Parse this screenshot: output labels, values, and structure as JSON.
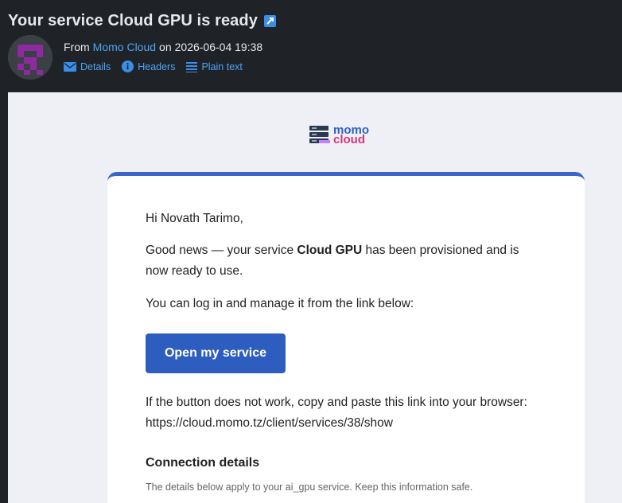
{
  "header": {
    "subject": "Your service Cloud GPU is ready",
    "from_prefix": "From",
    "sender": "Momo Cloud",
    "date_prefix": "on",
    "date": "2026-06-04 19:38",
    "actions": [
      {
        "label": "Details",
        "icon": "envelope-icon"
      },
      {
        "label": "Headers",
        "icon": "info-icon"
      },
      {
        "label": "Plain text",
        "icon": "lines-icon"
      }
    ]
  },
  "logo": {
    "line1": "momo",
    "line2": "cloud"
  },
  "email": {
    "greeting": "Hi Novath Tarimo,",
    "p1_a": "Good news — your service ",
    "p1_service": "Cloud GPU",
    "p1_b": " has been provisioned and is",
    "p1_c": "now ready to use.",
    "p2": "You can log in and manage it from the link below:",
    "cta_label": "Open my service",
    "p3": "If the button does not work, copy and paste this link into your browser:",
    "link": "https://cloud.momo.tz/client/services/38/show",
    "section_title": "Connection details",
    "section_note": "The details below apply to your ai_gpu service. Keep this information safe."
  },
  "colors": {
    "accent": "#2d5dbf",
    "link": "#4ea3f7",
    "header_bg": "#1f2327",
    "avatar": "#8e2aa0"
  }
}
